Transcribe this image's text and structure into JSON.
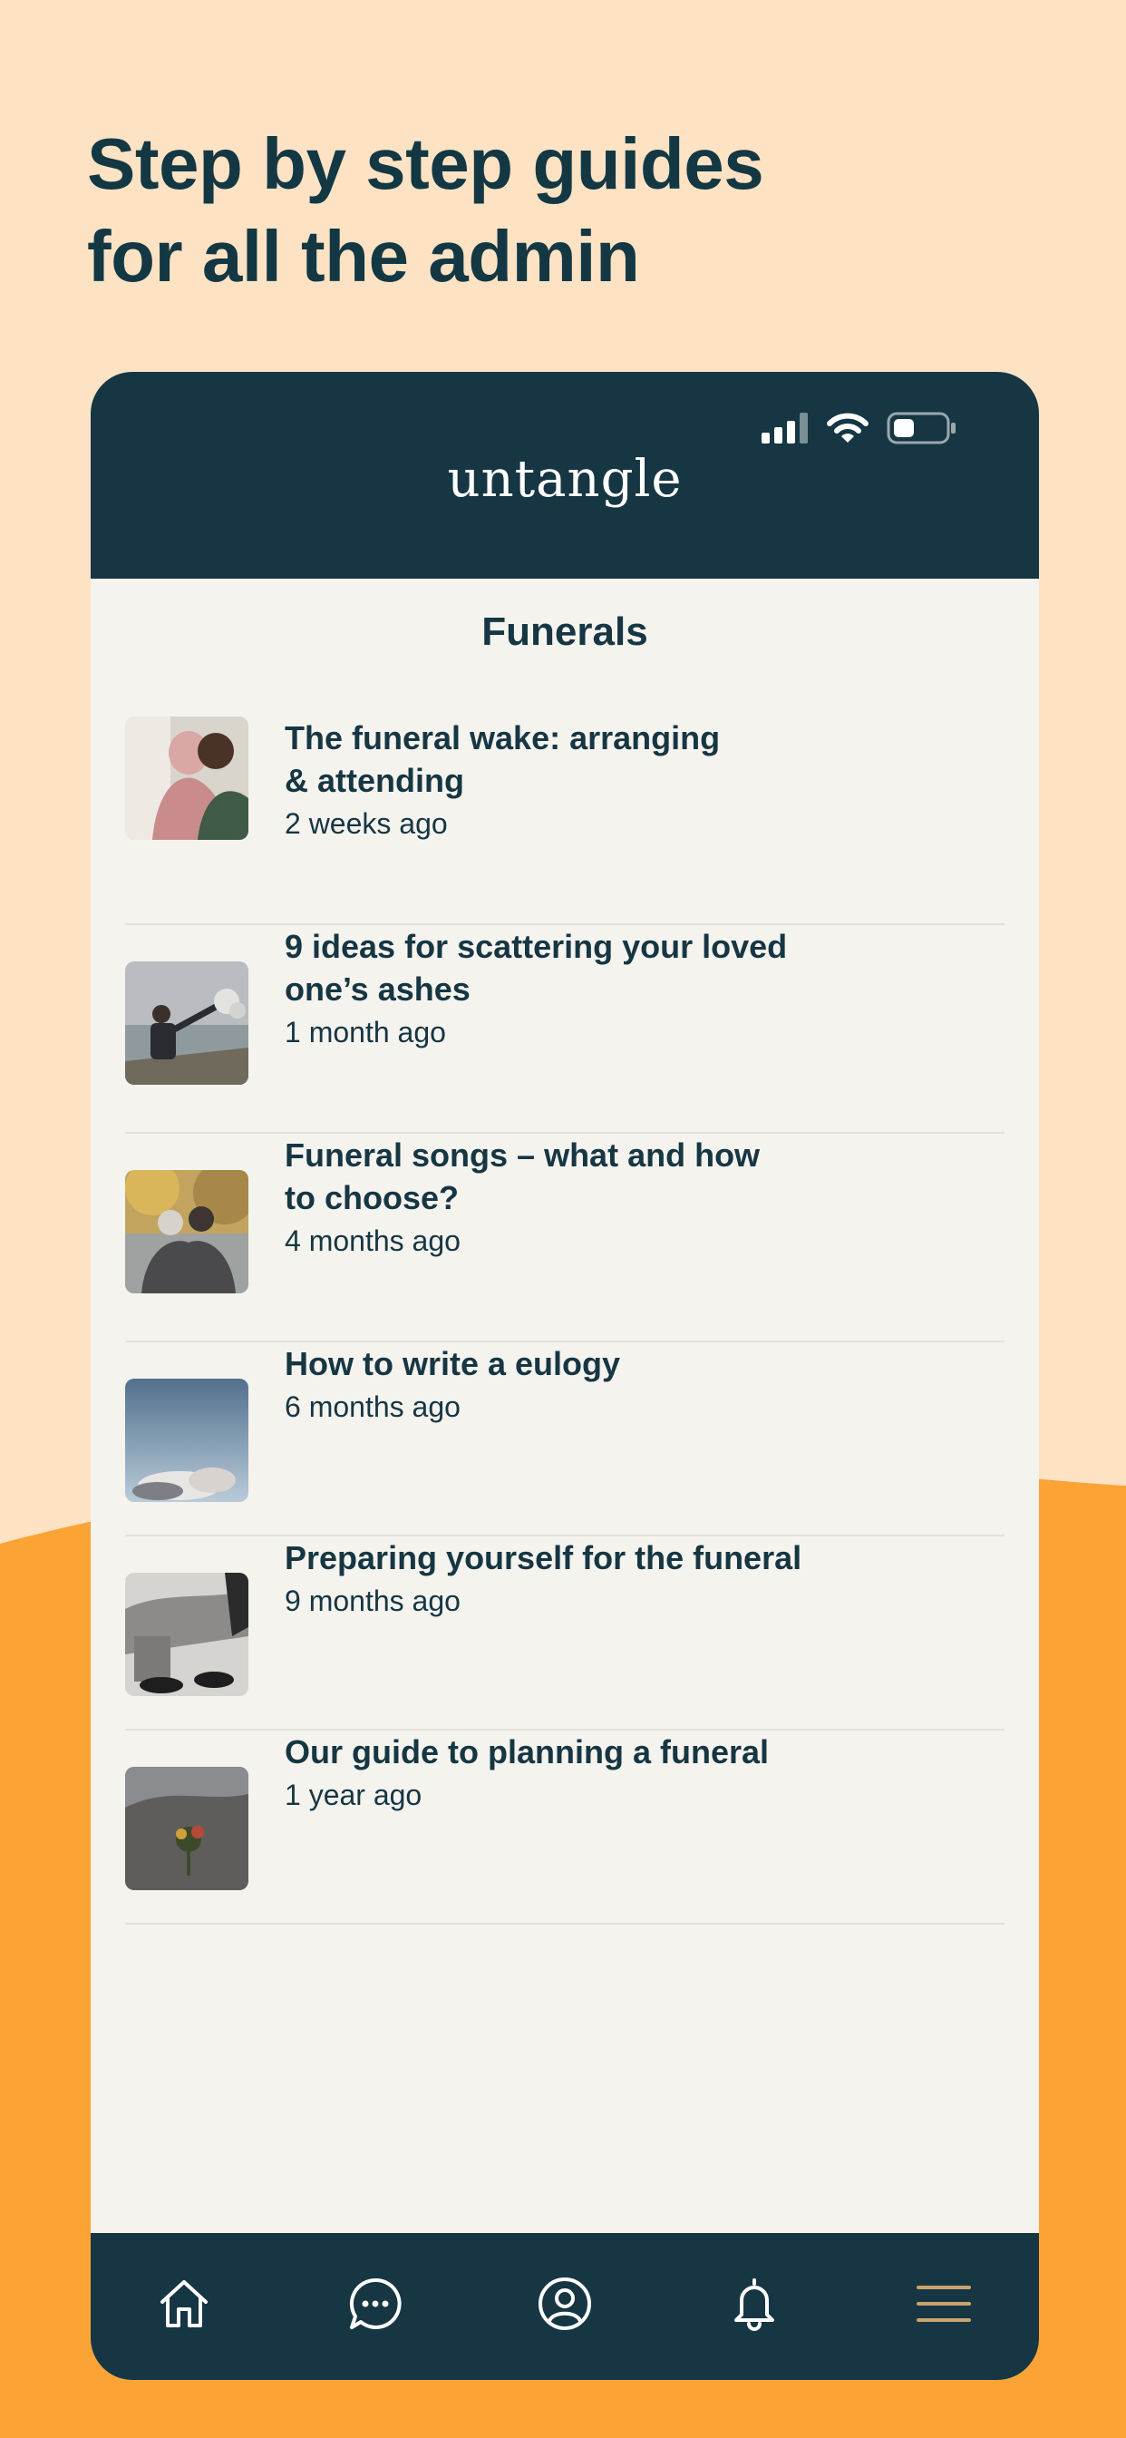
{
  "headline": {
    "line1": "Step by step guides",
    "line2": "for all the admin"
  },
  "colors": {
    "peach_background": "#FDE2C4",
    "orange_background": "#FBA435",
    "navy": "#163643",
    "screen_background": "#F5F3EE",
    "menu_accent": "#C9A36E"
  },
  "app": {
    "brand": "untangle",
    "status_icons": [
      "signal-icon",
      "wifi-icon",
      "battery-icon"
    ]
  },
  "screen": {
    "title": "Funerals"
  },
  "articles": [
    {
      "title_line1": "The funeral wake: arranging",
      "title_line2": "& attending",
      "time": "2 weeks ago",
      "thumbnail": "embracing-people-photo"
    },
    {
      "title_line1": "9 ideas for scattering your loved",
      "title_line2": "one’s ashes",
      "time": "1 month ago",
      "thumbnail": "scattering-ashes-photo"
    },
    {
      "title_line1": "Funeral songs – what and how",
      "title_line2": "to choose?",
      "time": "4 months ago",
      "thumbnail": "couple-autumn-photo"
    },
    {
      "title_line1": "How to write a eulogy",
      "title_line2": "",
      "time": "6 months ago",
      "thumbnail": "sky-clouds-photo"
    },
    {
      "title_line1": "Preparing yourself for the funeral",
      "title_line2": "",
      "time": "9 months ago",
      "thumbnail": "seated-legs-photo"
    },
    {
      "title_line1": "Our guide to planning a funeral",
      "title_line2": "",
      "time": "1 year ago",
      "thumbnail": "flowers-on-ground-photo"
    }
  ],
  "tabbar": {
    "items": [
      "home-icon",
      "chat-icon",
      "profile-icon",
      "notification-bell-icon",
      "menu-icon"
    ]
  }
}
